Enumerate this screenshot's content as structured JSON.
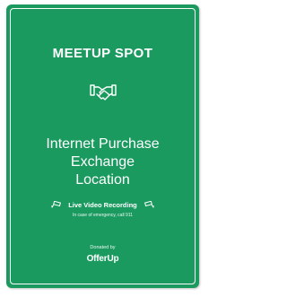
{
  "sign": {
    "title": "MEETUP SPOT",
    "icon": "handshake-icon",
    "headline": [
      "Internet Purchase",
      "Exchange",
      "Location"
    ],
    "live_label": "Live Video Recording",
    "emergency_note": "In case of emergency, call 911",
    "donated_label": "Donated by",
    "brand": "OfferUp"
  },
  "colors": {
    "background": "#1b9a60",
    "text": "#ffffff"
  }
}
